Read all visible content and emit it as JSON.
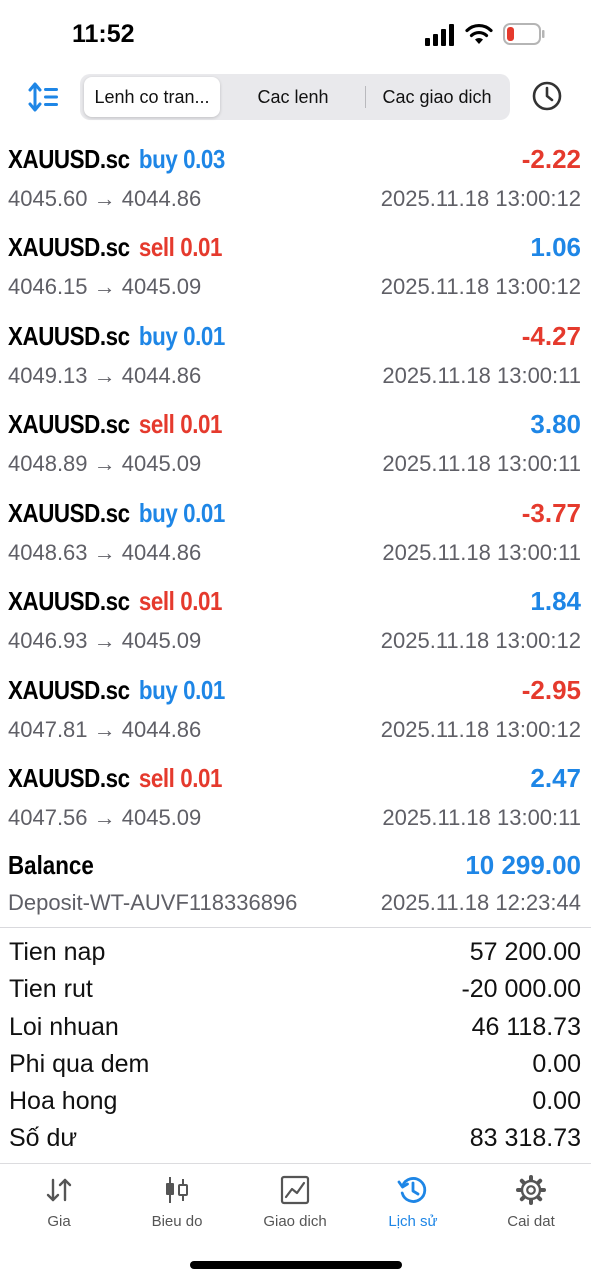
{
  "status_bar": {
    "time": "11:52"
  },
  "toolbar": {
    "segments": [
      {
        "label": "Lenh co tran..."
      },
      {
        "label": "Cac lenh"
      },
      {
        "label": "Cac giao dich"
      }
    ],
    "active_segment": 0
  },
  "deals": [
    {
      "symbol": "XAUUSD.sc",
      "type": "buy 0.03",
      "profit": "-2.22",
      "prices": "4045.60 → 4044.86",
      "datetime": "2025.11.18 13:00:12"
    },
    {
      "symbol": "XAUUSD.sc",
      "type": "sell 0.01",
      "profit": "1.06",
      "prices": "4046.15 → 4045.09",
      "datetime": "2025.11.18 13:00:12"
    },
    {
      "symbol": "XAUUSD.sc",
      "type": "buy 0.01",
      "profit": "-4.27",
      "prices": "4049.13 → 4044.86",
      "datetime": "2025.11.18 13:00:11"
    },
    {
      "symbol": "XAUUSD.sc",
      "type": "sell 0.01",
      "profit": "3.80",
      "prices": "4048.89 → 4045.09",
      "datetime": "2025.11.18 13:00:11"
    },
    {
      "symbol": "XAUUSD.sc",
      "type": "buy 0.01",
      "profit": "-3.77",
      "prices": "4048.63 → 4044.86",
      "datetime": "2025.11.18 13:00:11"
    },
    {
      "symbol": "XAUUSD.sc",
      "type": "sell 0.01",
      "profit": "1.84",
      "prices": "4046.93 → 4045.09",
      "datetime": "2025.11.18 13:00:12"
    },
    {
      "symbol": "XAUUSD.sc",
      "type": "buy 0.01",
      "profit": "-2.95",
      "prices": "4047.81 → 4044.86",
      "datetime": "2025.11.18 13:00:12"
    },
    {
      "symbol": "XAUUSD.sc",
      "type": "sell 0.01",
      "profit": "2.47",
      "prices": "4047.56 → 4045.09",
      "datetime": "2025.11.18 13:00:11"
    }
  ],
  "balance": {
    "label": "Balance",
    "amount": "10 299.00",
    "comment": "Deposit-WT-AUVF118336896",
    "datetime": "2025.11.18 12:23:44"
  },
  "summary": [
    {
      "label": "Tien nap",
      "value": "57 200.00"
    },
    {
      "label": "Tien rut",
      "value": "-20 000.00"
    },
    {
      "label": "Loi nhuan",
      "value": "46 118.73"
    },
    {
      "label": "Phi qua dem",
      "value": "0.00"
    },
    {
      "label": "Hoa hong",
      "value": "0.00"
    },
    {
      "label": "Số dư",
      "value": "83 318.73"
    }
  ],
  "tabbar": [
    {
      "label": "Gia",
      "icon": "arrows-updown-icon"
    },
    {
      "label": "Bieu do",
      "icon": "candlestick-icon"
    },
    {
      "label": "Giao dich",
      "icon": "trade-chart-icon"
    },
    {
      "label": "Lịch sử",
      "icon": "history-icon"
    },
    {
      "label": "Cai dat",
      "icon": "gear-icon"
    }
  ],
  "active_tab": 3,
  "colors": {
    "buy": "#1e86e6",
    "sell": "#e53a2d",
    "accent": "#1e86e6",
    "battery_low": "#e53a2d"
  }
}
